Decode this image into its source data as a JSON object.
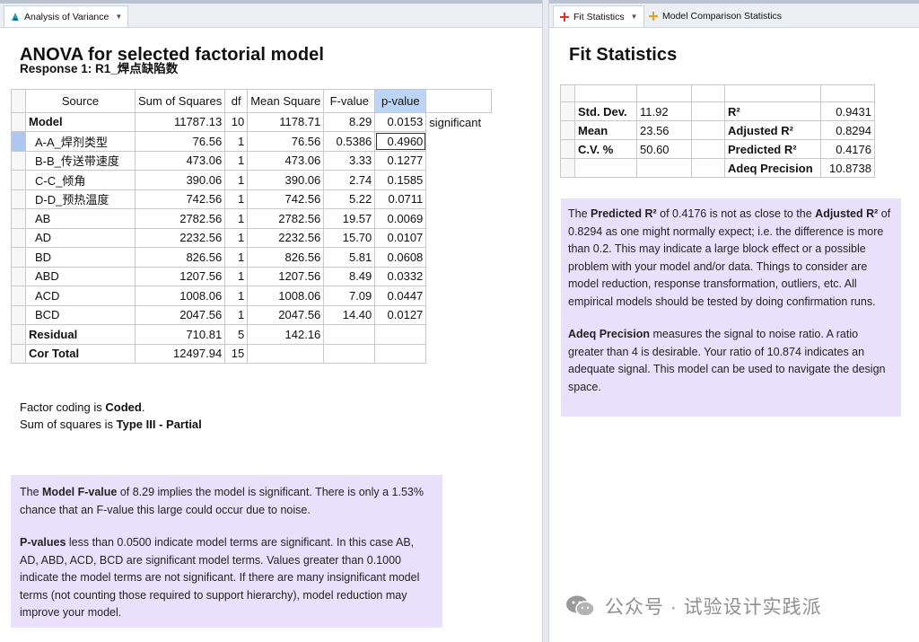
{
  "tabs": {
    "left": [
      {
        "label": "Analysis of Variance",
        "dropdown": "▼"
      }
    ],
    "right": [
      {
        "label": "Fit Statistics",
        "dropdown": "▼"
      },
      {
        "label": "Model Comparison Statistics"
      }
    ]
  },
  "anova": {
    "title": "ANOVA for selected factorial model",
    "response_label": "Response 1: R1_焊点缺陷数",
    "headers": [
      "Source",
      "Sum of Squares",
      "df",
      "Mean Square",
      "F-value",
      "p-value"
    ],
    "rows": [
      {
        "source": "Model",
        "ss": "11787.13",
        "df": "10",
        "ms": "1178.71",
        "f": "8.29",
        "p": "0.0153",
        "note": "significant"
      },
      {
        "source": "A-A_焊剂类型",
        "ss": "76.56",
        "df": "1",
        "ms": "76.56",
        "f": "0.5386",
        "p": "0.4960",
        "note": ""
      },
      {
        "source": "B-B_传送带速度",
        "ss": "473.06",
        "df": "1",
        "ms": "473.06",
        "f": "3.33",
        "p": "0.1277",
        "note": ""
      },
      {
        "source": "C-C_倾角",
        "ss": "390.06",
        "df": "1",
        "ms": "390.06",
        "f": "2.74",
        "p": "0.1585",
        "note": ""
      },
      {
        "source": "D-D_预热温度",
        "ss": "742.56",
        "df": "1",
        "ms": "742.56",
        "f": "5.22",
        "p": "0.0711",
        "note": ""
      },
      {
        "source": "AB",
        "ss": "2782.56",
        "df": "1",
        "ms": "2782.56",
        "f": "19.57",
        "p": "0.0069",
        "note": ""
      },
      {
        "source": "AD",
        "ss": "2232.56",
        "df": "1",
        "ms": "2232.56",
        "f": "15.70",
        "p": "0.0107",
        "note": ""
      },
      {
        "source": "BD",
        "ss": "826.56",
        "df": "1",
        "ms": "826.56",
        "f": "5.81",
        "p": "0.0608",
        "note": ""
      },
      {
        "source": "ABD",
        "ss": "1207.56",
        "df": "1",
        "ms": "1207.56",
        "f": "8.49",
        "p": "0.0332",
        "note": ""
      },
      {
        "source": "ACD",
        "ss": "1008.06",
        "df": "1",
        "ms": "1008.06",
        "f": "7.09",
        "p": "0.0447",
        "note": ""
      },
      {
        "source": "BCD",
        "ss": "2047.56",
        "df": "1",
        "ms": "2047.56",
        "f": "14.40",
        "p": "0.0127",
        "note": ""
      },
      {
        "source": "Residual",
        "ss": "710.81",
        "df": "5",
        "ms": "142.16",
        "f": "",
        "p": "",
        "note": ""
      },
      {
        "source": "Cor Total",
        "ss": "12497.94",
        "df": "15",
        "ms": "",
        "f": "",
        "p": "",
        "note": ""
      }
    ],
    "coding_prefix": "Factor coding is ",
    "coding_value": "Coded",
    "coding_suffix": ".",
    "ss_prefix": "Sum of squares is ",
    "ss_value": "Type III - Partial",
    "info": {
      "p1_pre": "The ",
      "p1_bold": "Model F-value",
      "p1_rest": " of 8.29 implies the model is significant. There is only a 1.53% chance that an F-value this large could occur due to noise.",
      "p2_bold": "P-values",
      "p2_rest": " less than 0.0500 indicate model terms are significant. In this case AB, AD, ABD, ACD, BCD are significant model terms. Values greater than 0.1000 indicate the model terms are not significant. If there are many insignificant model terms (not counting those required to support hierarchy), model reduction may improve your model."
    }
  },
  "fit": {
    "title": "Fit Statistics",
    "rows": [
      {
        "l1": "Std. Dev.",
        "v1": "11.92",
        "l2": "R²",
        "v2": "0.9431"
      },
      {
        "l1": "Mean",
        "v1": "23.56",
        "l2": "Adjusted R²",
        "v2": "0.8294"
      },
      {
        "l1": "C.V. %",
        "v1": "50.60",
        "l2": "Predicted R²",
        "v2": "0.4176"
      },
      {
        "l1": "",
        "v1": "",
        "l2": "Adeq Precision",
        "v2": "10.8738"
      }
    ],
    "info": {
      "a1": "The ",
      "a2": "Predicted R²",
      "a3": " of 0.4176 is not as close to the ",
      "a4": "Adjusted R²",
      "a5": " of 0.8294 as one might normally expect; i.e. the difference is more than 0.2. This may indicate a large block effect or a possible problem with your model and/or data. Things to consider are model reduction, response transformation, outliers, etc. All empirical models should be tested by doing confirmation runs.",
      "b1": "Adeq Precision",
      "b2": " measures the signal to noise ratio. A ratio greater than 4 is desirable. Your ratio of 10.874 indicates an adequate signal. This model can be used to navigate the design space."
    }
  },
  "watermark": "公众号 · 试验设计实践派",
  "colors": {
    "info_bg": "#e9e1fb",
    "pvalue_header": "#bcd5f7",
    "selected_row": "#aac8f3"
  }
}
